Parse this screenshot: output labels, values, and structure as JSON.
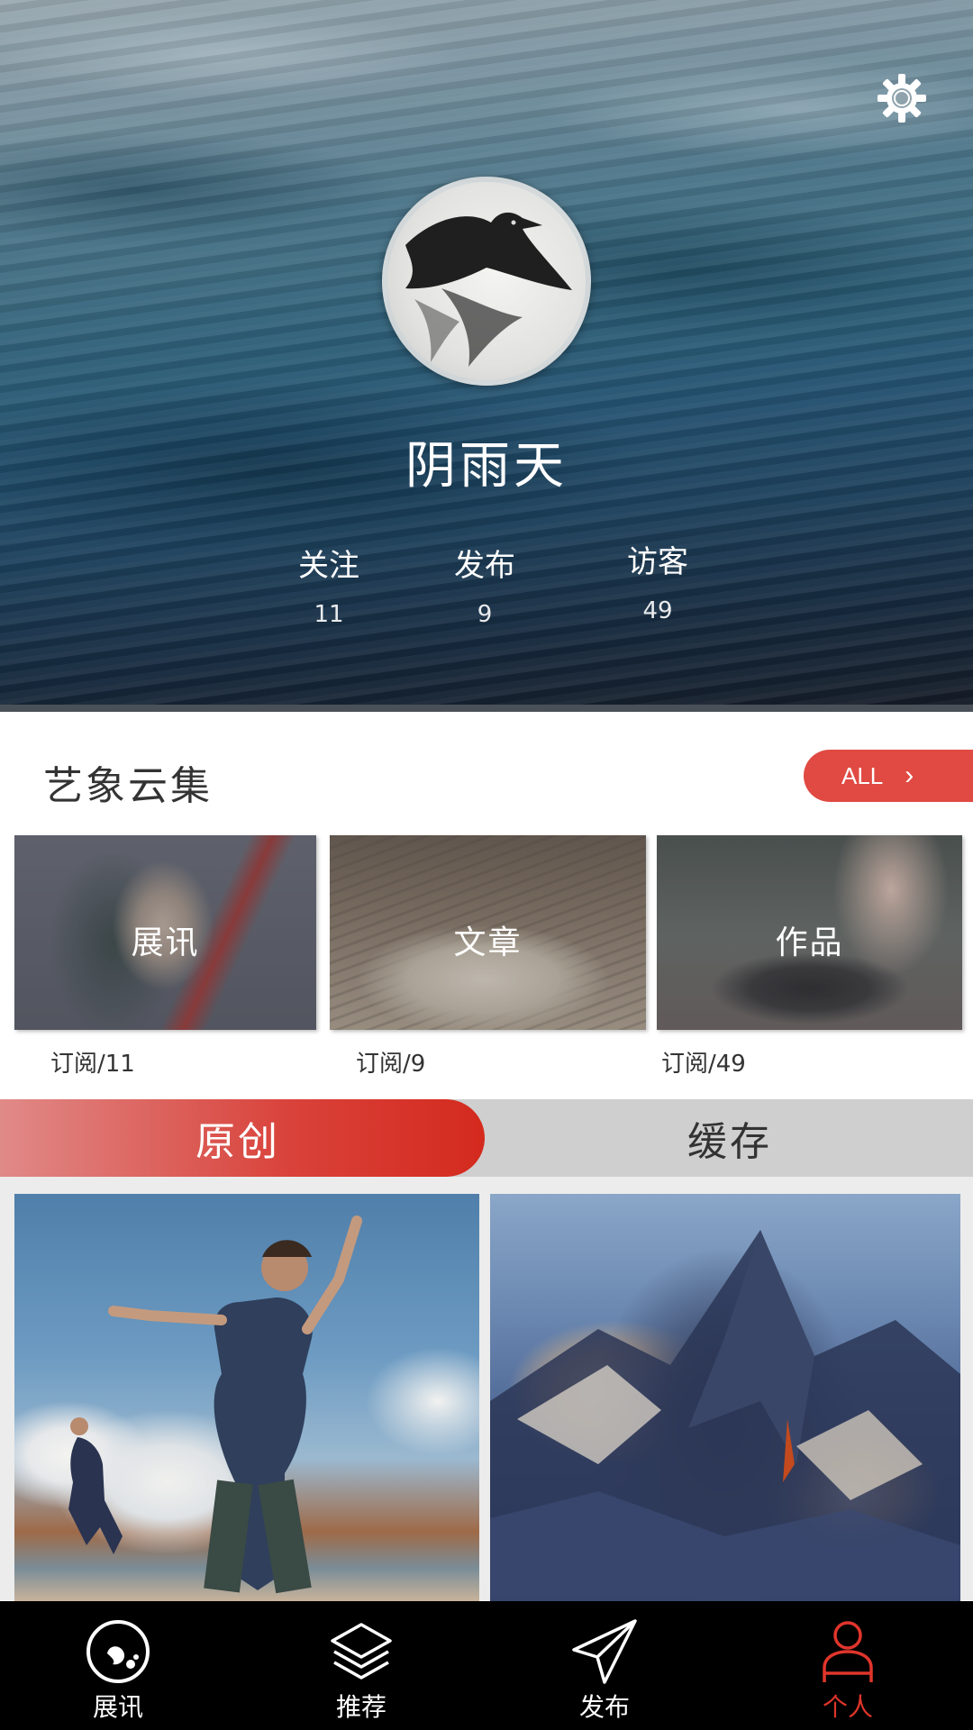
{
  "profile": {
    "username": "阴雨天",
    "stats": [
      {
        "label": "关注",
        "value": "11"
      },
      {
        "label": "发布",
        "value": "9"
      },
      {
        "label": "访客",
        "value": "49"
      }
    ]
  },
  "collection": {
    "title": "艺象云集",
    "all_label": "ALL",
    "cards": [
      {
        "label": "展讯",
        "subscribe": "订阅/11"
      },
      {
        "label": "文章",
        "subscribe": "订阅/9"
      },
      {
        "label": "作品",
        "subscribe": "订阅/49"
      }
    ]
  },
  "tabs": [
    {
      "label": "原创",
      "active": true
    },
    {
      "label": "缓存",
      "active": false
    }
  ],
  "bottom_nav": [
    {
      "label": "展讯",
      "icon": "news-icon"
    },
    {
      "label": "推荐",
      "icon": "layers-icon"
    },
    {
      "label": "发布",
      "icon": "paper-plane-icon"
    },
    {
      "label": "个人",
      "icon": "user-icon",
      "active": true
    }
  ],
  "colors": {
    "accent": "#e04a42",
    "tab_active": "#d42a1e",
    "nav_active": "#e0352b"
  }
}
